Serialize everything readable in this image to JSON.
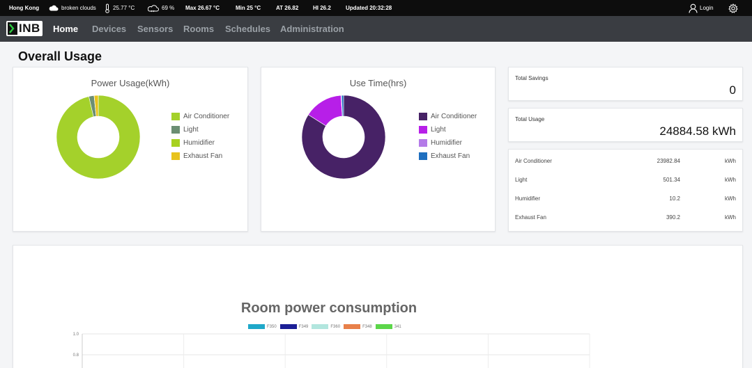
{
  "weather": {
    "city": "Hong Kong",
    "condition": "broken clouds",
    "temperature": "25.77 °C",
    "humidity": "69 %",
    "max": "Max 26.67 °C",
    "min": "Min 25 °C",
    "at": "AT 26.82",
    "hi": "HI 26.2",
    "updated": "Updated 20:32:28",
    "login": "Login"
  },
  "brand": {
    "logo_text": "INB"
  },
  "nav": {
    "items": [
      {
        "label": "Home",
        "active": true
      },
      {
        "label": "Devices",
        "active": false
      },
      {
        "label": "Sensors",
        "active": false
      },
      {
        "label": "Rooms",
        "active": false
      },
      {
        "label": "Schedules",
        "active": false
      },
      {
        "label": "Administration",
        "active": false
      }
    ]
  },
  "page": {
    "title": "Overall Usage"
  },
  "power_chart": {
    "title": "Power Usage(kWh)",
    "legend": [
      {
        "label": "Air Conditioner",
        "color": "#a4d12b"
      },
      {
        "label": "Light",
        "color": "#6b8e73"
      },
      {
        "label": "Humidifier",
        "color": "#a7d11f"
      },
      {
        "label": "Exhaust Fan",
        "color": "#e8c31d"
      }
    ]
  },
  "time_chart": {
    "title": "Use Time(hrs)",
    "legend": [
      {
        "label": "Air Conditioner",
        "color": "#472266"
      },
      {
        "label": "Light",
        "color": "#b71fe8"
      },
      {
        "label": "Humidifier",
        "color": "#b47be8"
      },
      {
        "label": "Exhaust Fan",
        "color": "#1f6fbf"
      }
    ]
  },
  "stats": {
    "total_savings_label": "Total Savings",
    "total_savings_value": "0",
    "total_usage_label": "Total Usage",
    "total_usage_value": "24884.58 kWh"
  },
  "usage_table": [
    {
      "name": "Air Conditioner",
      "value": "23982.84",
      "unit": "kWh"
    },
    {
      "name": "Light",
      "value": "501.34",
      "unit": "kWh"
    },
    {
      "name": "Humidifier",
      "value": "10.2",
      "unit": "kWh"
    },
    {
      "name": "Exhaust Fan",
      "value": "390.2",
      "unit": "kWh"
    }
  ],
  "chart_data": [
    {
      "type": "pie",
      "title": "Power Usage(kWh)",
      "categories": [
        "Air Conditioner",
        "Light",
        "Humidifier",
        "Exhaust Fan"
      ],
      "values": [
        23982.84,
        501.34,
        10.2,
        390.2
      ],
      "colors": [
        "#a4d12b",
        "#6b8e73",
        "#a7d11f",
        "#e8c31d"
      ],
      "legend": "right"
    },
    {
      "type": "pie",
      "title": "Use Time(hrs)",
      "categories": [
        "Air Conditioner",
        "Light",
        "Humidifier",
        "Exhaust Fan"
      ],
      "values": [
        84,
        15,
        0.2,
        0.8
      ],
      "colors": [
        "#472266",
        "#b71fe8",
        "#b47be8",
        "#1f6fbf"
      ],
      "legend": "right"
    },
    {
      "type": "bar",
      "title": "Room power consumption",
      "series": [
        {
          "name": "F350",
          "color": "#1fa8c9"
        },
        {
          "name": "F349",
          "color": "#1c1f96"
        },
        {
          "name": "F360",
          "color": "#b2e6de"
        },
        {
          "name": "F348",
          "color": "#e8804a"
        },
        {
          "name": "341",
          "color": "#5cd64a"
        }
      ],
      "ylim": [
        0,
        1.0
      ],
      "yticks": [
        "1.0",
        "0.8"
      ],
      "grid": true,
      "legend": "top"
    }
  ]
}
